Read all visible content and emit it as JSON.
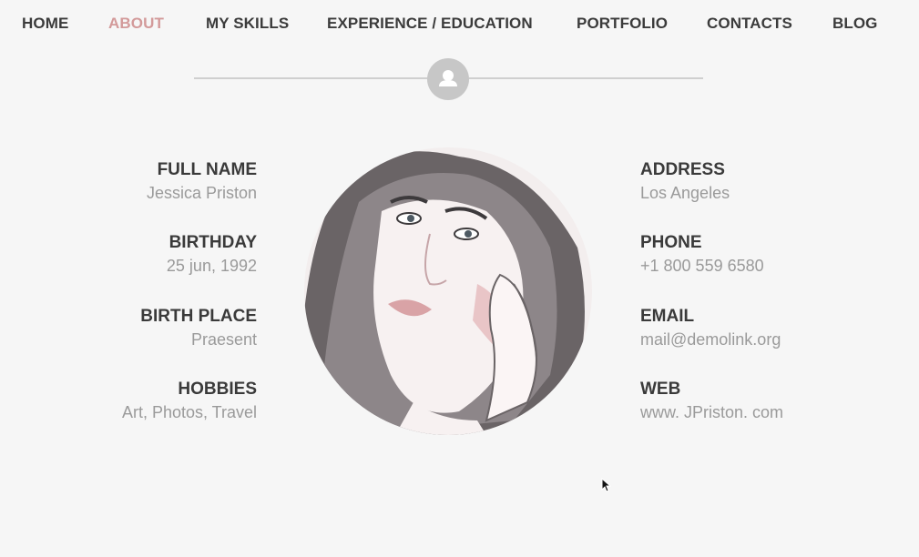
{
  "nav": {
    "items": [
      {
        "label": "HOME"
      },
      {
        "label": "ABOUT"
      },
      {
        "label": "MY SKILLS"
      },
      {
        "label": "EXPERIENCE / EDUCATION"
      },
      {
        "label": "PORTFOLIO"
      },
      {
        "label": "CONTACTS"
      },
      {
        "label": "BLOG"
      }
    ],
    "active": "ABOUT"
  },
  "divider": {
    "icon": "user-icon"
  },
  "left_info": [
    {
      "label": "FULL NAME",
      "value": "Jessica Priston"
    },
    {
      "label": "BIRTHDAY",
      "value": "25 jun, 1992"
    },
    {
      "label": "BIRTH PLACE",
      "value": "Praesent"
    },
    {
      "label": "HOBBIES",
      "value": "Art,  Photos, Travel"
    }
  ],
  "right_info": [
    {
      "label": "ADDRESS",
      "value": "Los Angeles"
    },
    {
      "label": "PHONE",
      "value": "+1 800 559 6580"
    },
    {
      "label": "EMAIL",
      "value": "mail@demolink.org"
    },
    {
      "label": "WEB",
      "value": "www. JPriston. com"
    }
  ],
  "colors": {
    "background": "#f6f6f6",
    "nav_text": "#3b3b3b",
    "nav_active": "#d39a9a",
    "label": "#3a3a3a",
    "value": "#9a9a9a",
    "divider": "#cfcfcf"
  }
}
